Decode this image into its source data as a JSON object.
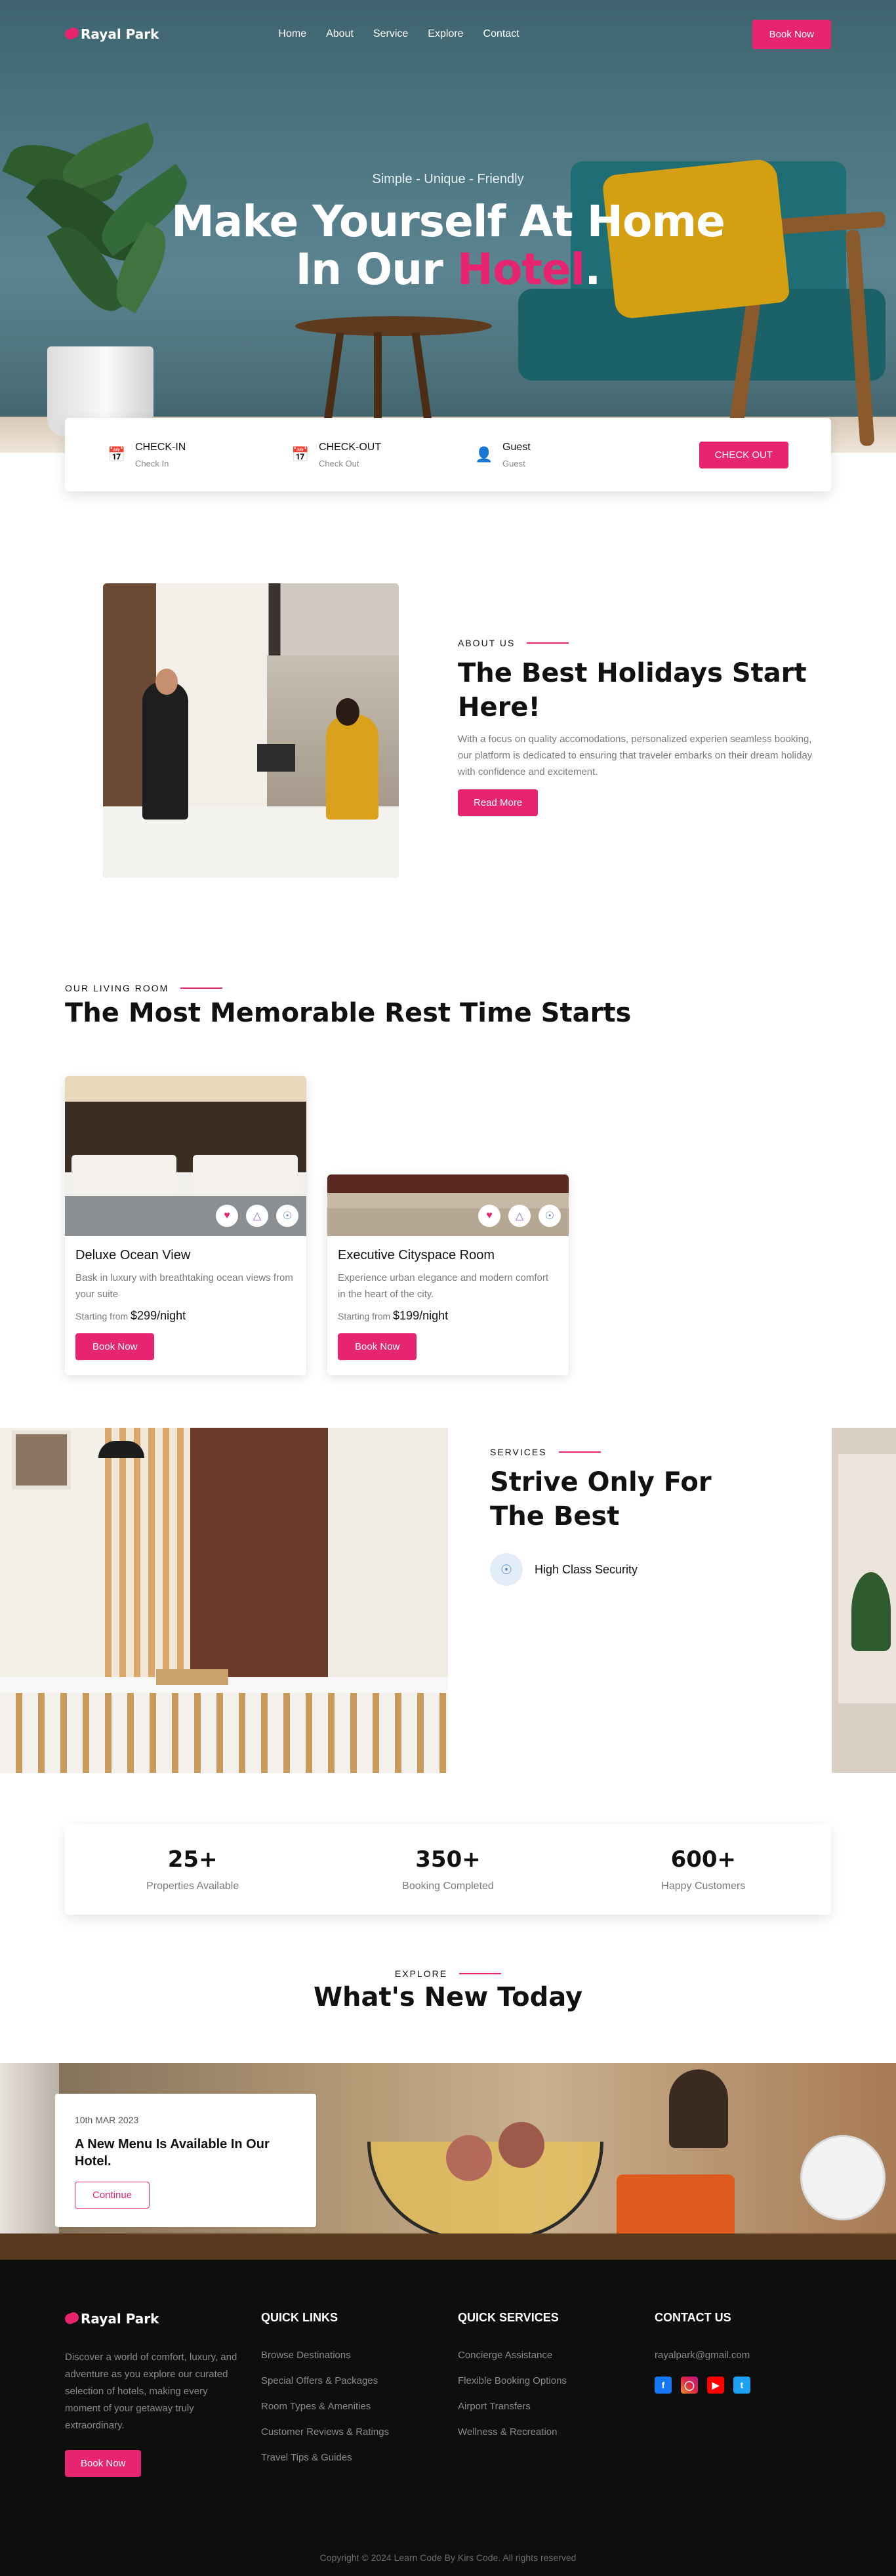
{
  "brand": {
    "name": "Rayal Park",
    "accent": "#e6246f"
  },
  "nav": {
    "links": [
      "Home",
      "About",
      "Service",
      "Explore",
      "Contact"
    ],
    "cta": "Book Now"
  },
  "hero": {
    "subtitle": "Simple - Unique - Friendly",
    "title_line1": "Make Yourself At Home",
    "title_line2_pre": "In Our ",
    "title_line2_accent": "Hotel",
    "title_line2_post": "."
  },
  "booking": {
    "fields": [
      {
        "label": "CHECK-IN",
        "placeholder": "Check In",
        "icon": "calendar-icon"
      },
      {
        "label": "CHECK-OUT",
        "placeholder": "Check Out",
        "icon": "calendar-icon"
      },
      {
        "label": "Guest",
        "placeholder": "Guest",
        "icon": "user-icon"
      }
    ],
    "button": "CHECK OUT"
  },
  "about": {
    "tag": "ABOUT US",
    "title": "The Best Holidays Start Here!",
    "text": "With a focus on quality accomodations, personalized experien seamless booking, our platform is dedicated to ensuring that traveler embarks on their dream holiday with confidence and excitement.",
    "button": "Read More"
  },
  "rooms": {
    "tag": "OUR LIVING ROOM",
    "title": "The Most Memorable Rest Time Starts",
    "items": [
      {
        "title": "Deluxe Ocean View",
        "desc": "Bask in luxury with breathtaking ocean views from your suite",
        "price_prefix": "Starting from",
        "price": "$299/night",
        "button": "Book Now"
      },
      {
        "title": "Executive Cityspace Room",
        "desc": "Experience urban elegance and modern comfort in the heart of the city.",
        "price_prefix": "Starting from",
        "price": "$199/night",
        "button": "Book Now"
      }
    ]
  },
  "services": {
    "tag": "SERVICES",
    "title": "Strive Only For The Best",
    "items": [
      {
        "label": "High Class Security",
        "icon": "shield-icon"
      }
    ]
  },
  "stats": [
    {
      "value": "25+",
      "label": "Properties Available"
    },
    {
      "value": "350+",
      "label": "Booking Completed"
    },
    {
      "value": "600+",
      "label": "Happy Customers"
    }
  ],
  "explore": {
    "tag": "EXPLORE",
    "title": "What's New Today",
    "card": {
      "date": "10th MAR 2023",
      "title": "A New Menu Is Available In Our Hotel.",
      "button": "Continue"
    }
  },
  "footer": {
    "about": "Discover a world of comfort, luxury, and adventure as you explore our curated selection of hotels, making every moment of your getaway truly extraordinary.",
    "button": "Book Now",
    "quick_links": {
      "title": "QUICK LINKS",
      "items": [
        "Browse Destinations",
        "Special Offers & Packages",
        "Room Types & Amenities",
        "Customer Reviews & Ratings",
        "Travel Tips & Guides"
      ]
    },
    "quick_services": {
      "title": "QUICK SERVICES",
      "items": [
        "Concierge Assistance",
        "Flexible Booking Options",
        "Airport Transfers",
        "Wellness & Recreation"
      ]
    },
    "contact": {
      "title": "CONTACT US",
      "email": "rayalpark@gmail.com",
      "social": [
        "facebook-icon",
        "instagram-icon",
        "youtube-icon",
        "twitter-icon"
      ]
    },
    "copyright": "Copyright © 2024 Learn Code By Kirs Code. All rights reserved"
  }
}
